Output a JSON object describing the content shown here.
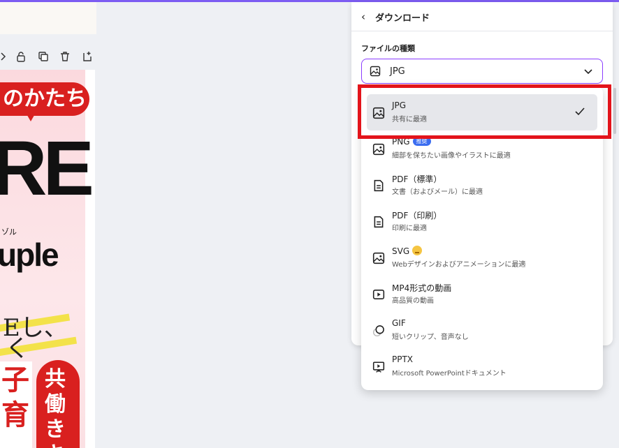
{
  "toolbar": {
    "icons": [
      "arrow-icon",
      "lock-icon",
      "duplicate-icon",
      "trash-icon",
      "add-page-icon"
    ]
  },
  "poster": {
    "bubble_text": "のかたち",
    "big_text": "RE",
    "small_text": "ゾル",
    "couple_text": "uple",
    "serif_line1": "Eし、",
    "serif_line2": "く",
    "ko_text": "子育",
    "pill_text": "共働きキ",
    "accent_color": "#d9201f"
  },
  "panel": {
    "back_label": "‹",
    "title": "ダウンロード",
    "filetype_label": "ファイルの種類",
    "selected_value": "JPG",
    "accent_color": "#8b3dff"
  },
  "dropdown": {
    "options": [
      {
        "name": "JPG",
        "desc": "共有に最適",
        "icon": "image-icon",
        "selected": true
      },
      {
        "name": "PNG",
        "desc": "細部を保ちたい画像やイラストに最適",
        "icon": "image-icon",
        "badge": "推奨"
      },
      {
        "name": "PDF（標準）",
        "desc": "文書（およびメール）に最適",
        "icon": "document-icon"
      },
      {
        "name": "PDF（印刷）",
        "desc": "印刷に最適",
        "icon": "document-icon"
      },
      {
        "name": "SVG",
        "desc": "Webデザインおよびアニメーションに最適",
        "icon": "image-icon",
        "premium": true
      },
      {
        "name": "MP4形式の動画",
        "desc": "高品質の動画",
        "icon": "video-icon"
      },
      {
        "name": "GIF",
        "desc": "短いクリップ、音声なし",
        "icon": "gif-icon"
      },
      {
        "name": "PPTX",
        "desc": "Microsoft PowerPointドキュメント",
        "icon": "presentation-icon"
      }
    ]
  },
  "colors": {
    "highlight": "#e3141b",
    "badge": "#3b6df0",
    "selected_row": "#e6e7eb"
  }
}
